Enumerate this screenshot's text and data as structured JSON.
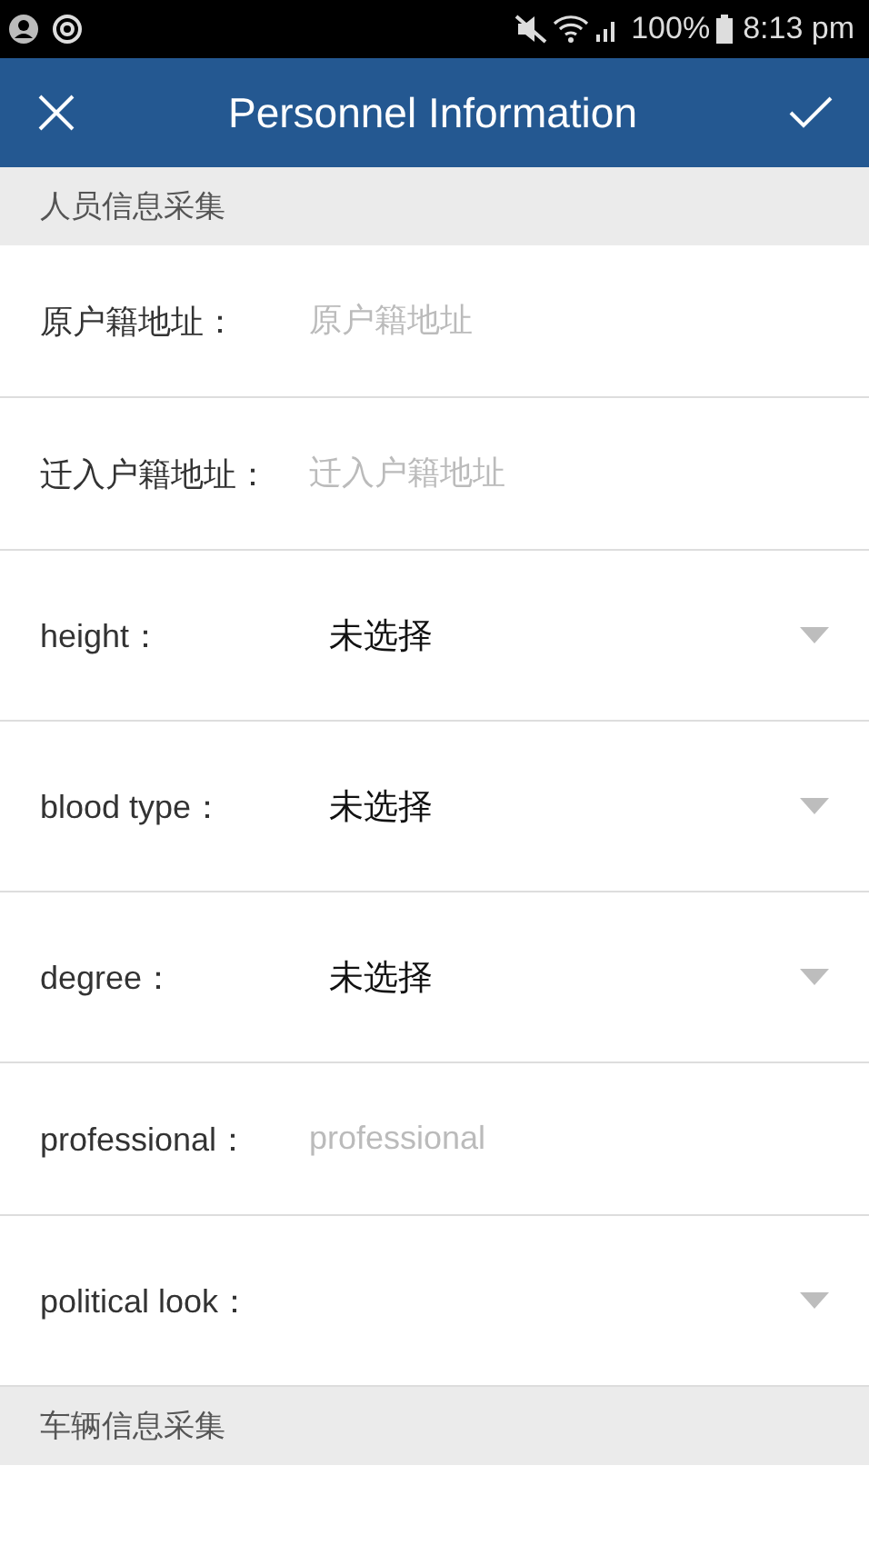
{
  "status_bar": {
    "battery": "100%",
    "time": "8:13 pm"
  },
  "header": {
    "title": "Personnel Information"
  },
  "sections": [
    {
      "title": "人员信息采集",
      "fields": [
        {
          "kind": "input",
          "label": "原户籍地址：",
          "placeholder": "原户籍地址"
        },
        {
          "kind": "input",
          "label": "迁入户籍地址：",
          "placeholder": "迁入户籍地址"
        },
        {
          "kind": "select",
          "label": "height：",
          "value": "未选择"
        },
        {
          "kind": "select",
          "label": "blood type：",
          "value": "未选择"
        },
        {
          "kind": "select",
          "label": "degree：",
          "value": "未选择"
        },
        {
          "kind": "input",
          "label": "professional：",
          "placeholder": "professional"
        },
        {
          "kind": "select",
          "label": "political look："
        }
      ]
    },
    {
      "title": "车辆信息采集"
    }
  ]
}
